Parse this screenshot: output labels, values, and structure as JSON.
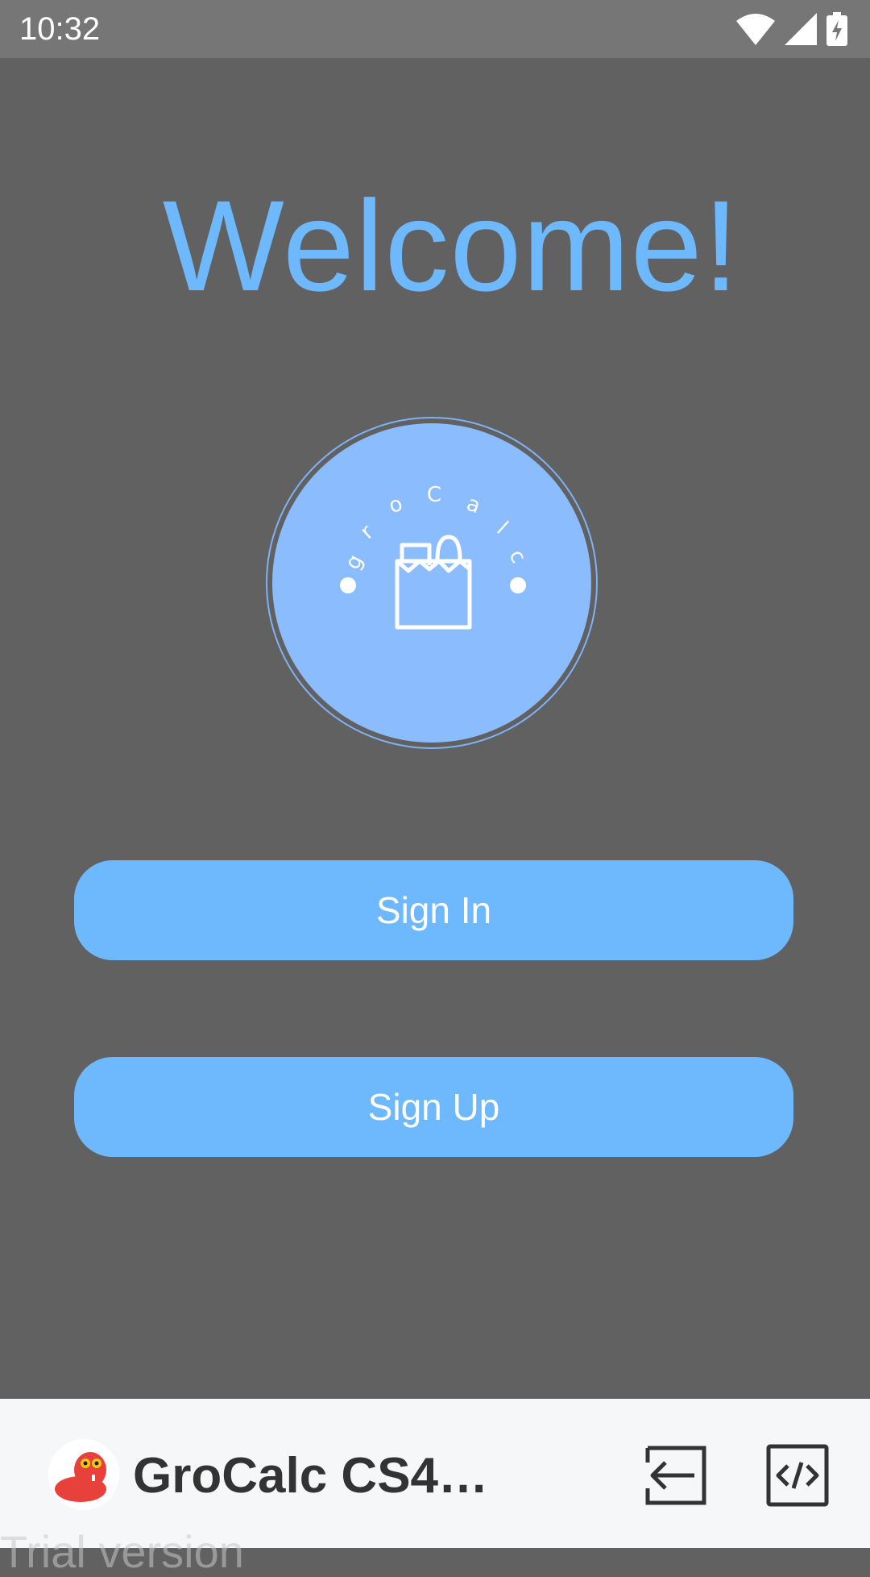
{
  "status_bar": {
    "time": "10:32",
    "icons": [
      "wifi-icon",
      "cellular-signal-icon",
      "battery-charging-icon"
    ]
  },
  "main": {
    "heading": "Welcome!",
    "logo": {
      "text": "groCalc",
      "icon": "grocery-bag-icon"
    },
    "sign_in_label": "Sign In",
    "sign_up_label": "Sign Up"
  },
  "bottom_bar": {
    "app_title": "GroCalc CS4R...",
    "avatar_icon": "app-mascot-icon",
    "exit_icon": "exit-arrow-icon",
    "code_icon": "code-icon",
    "watermark": "Trial version"
  },
  "colors": {
    "background": "#616161",
    "accent": "#6eb8fd",
    "logo_circle": "#8bbcfd",
    "status_bar": "#767676",
    "bottom_bar": "#f6f7f9"
  }
}
